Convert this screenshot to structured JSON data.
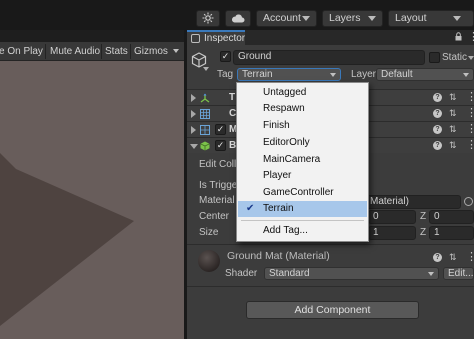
{
  "toolbar": {
    "account_label": "Account",
    "layers_label": "Layers",
    "layout_label": "Layout"
  },
  "game_view": {
    "toolbar_items": [
      "e On Play",
      "Mute Audio",
      "Stats",
      "Gizmos"
    ]
  },
  "inspector": {
    "tab_label": "Inspector",
    "object_name": "Ground",
    "static_label": "Static",
    "tag_label": "Tag",
    "tag_value": "Terrain",
    "layer_label": "Layer",
    "layer_value": "Default",
    "components": [
      {
        "name_visible": "T",
        "icon": "transform-icon",
        "enabled_checkbox": false
      },
      {
        "name_visible": "C",
        "icon": "mesh-filter-icon",
        "enabled_checkbox": false
      },
      {
        "name_visible": "M",
        "icon": "mesh-renderer-icon",
        "enabled_checkbox": true
      },
      {
        "name_visible": "B",
        "icon": "box-collider-icon",
        "enabled_checkbox": true
      }
    ],
    "collider": {
      "edit_label": "Edit Colli",
      "is_trigger_label": "Is Trigge",
      "material_label": "Material",
      "material_value": "Material)",
      "center_label": "Center",
      "size_label": "Size",
      "center_y": "0",
      "center_z_label": "Z",
      "center_z": "0",
      "size_y": "1",
      "size_z_label": "Z",
      "size_z": "1"
    },
    "material": {
      "name": "Ground Mat (Material)",
      "shader_label": "Shader",
      "shader_value": "Standard",
      "edit_label": "Edit..."
    },
    "add_component_label": "Add Component"
  },
  "tag_menu": {
    "items": [
      "Untagged",
      "Respawn",
      "Finish",
      "EditorOnly",
      "MainCamera",
      "Player",
      "GameController",
      "Terrain"
    ],
    "selected": "Terrain",
    "add_tag_label": "Add Tag..."
  },
  "colors": {
    "game_view_bg": "#685d5b",
    "terrain_plane": "#4e4340",
    "selection": "#a7c7ea",
    "accent": "#3a79bb"
  }
}
